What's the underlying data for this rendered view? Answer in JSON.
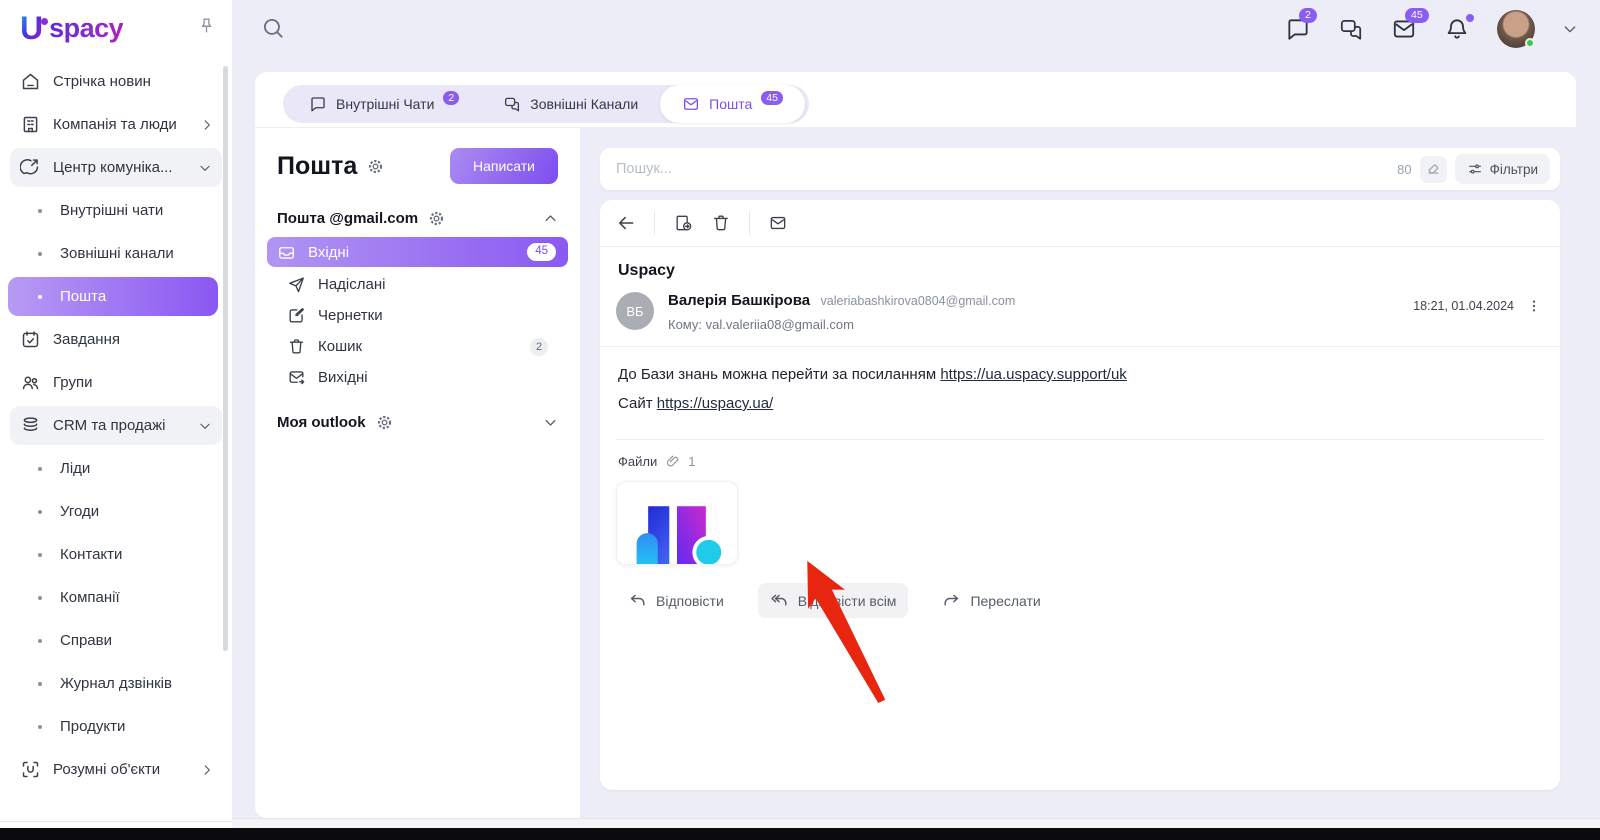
{
  "app": {
    "logo_u": "U",
    "logo_text": "spacy"
  },
  "header": {
    "chat_badge": "2",
    "mail_badge": "45"
  },
  "sidebar": {
    "items": [
      {
        "label": "Стрічка новин"
      },
      {
        "label": "Компанія та люди"
      },
      {
        "label": "Центр комуніка..."
      },
      {
        "label": "Внутрішні чати"
      },
      {
        "label": "Зовнішні канали"
      },
      {
        "label": "Пошта"
      },
      {
        "label": "Завдання"
      },
      {
        "label": "Групи"
      },
      {
        "label": "CRM та продажі"
      },
      {
        "label": "Ліди"
      },
      {
        "label": "Угоди"
      },
      {
        "label": "Контакти"
      },
      {
        "label": "Компанії"
      },
      {
        "label": "Справи"
      },
      {
        "label": "Журнал дзвінків"
      },
      {
        "label": "Продукти"
      },
      {
        "label": "Розумні об'єкти"
      }
    ]
  },
  "tabs": {
    "internal": {
      "label": "Внутрішні Чати",
      "badge": "2"
    },
    "external": {
      "label": "Зовнішні Канали"
    },
    "mail": {
      "label": "Пошта",
      "badge": "45"
    }
  },
  "mail_panel": {
    "title": "Пошта",
    "compose_label": "Написати",
    "gmail_account": "Пошта @gmail.com",
    "outlook_account": "Моя outlook",
    "folders": {
      "inbox": {
        "label": "Вхідні",
        "badge": "45"
      },
      "sent": {
        "label": "Надіслані"
      },
      "drafts": {
        "label": "Чернетки"
      },
      "trash": {
        "label": "Кошик",
        "badge": "2"
      },
      "outbox": {
        "label": "Вихідні"
      }
    }
  },
  "search": {
    "placeholder": "Пошук...",
    "count": "80",
    "filters_label": "Фільтри"
  },
  "email": {
    "subject": "Uspacy",
    "sender_initials": "ВБ",
    "sender_name": "Валерія Башкірова",
    "sender_email": "valeriabashkirova0804@gmail.com",
    "to_line": "Кому: val.valeriia08@gmail.com",
    "datetime": "18:21, 01.04.2024",
    "body_line1_text": "До Бази знань можна перейти за посиланням ",
    "body_line1_link": "https://ua.uspacy.support/uk",
    "body_line2_text": "Сайт ",
    "body_line2_link": "https://uspacy.ua/",
    "files_label": "Файли",
    "files_count": "1",
    "reply_label": "Відповісти",
    "reply_all_label": "Відповісти всім",
    "forward_label": "Переслати"
  },
  "colors": {
    "accent": "#8a5cf0",
    "annotation_arrow": "#e8250e",
    "inbox_gradient": "#b195f3→#8a59f2"
  }
}
